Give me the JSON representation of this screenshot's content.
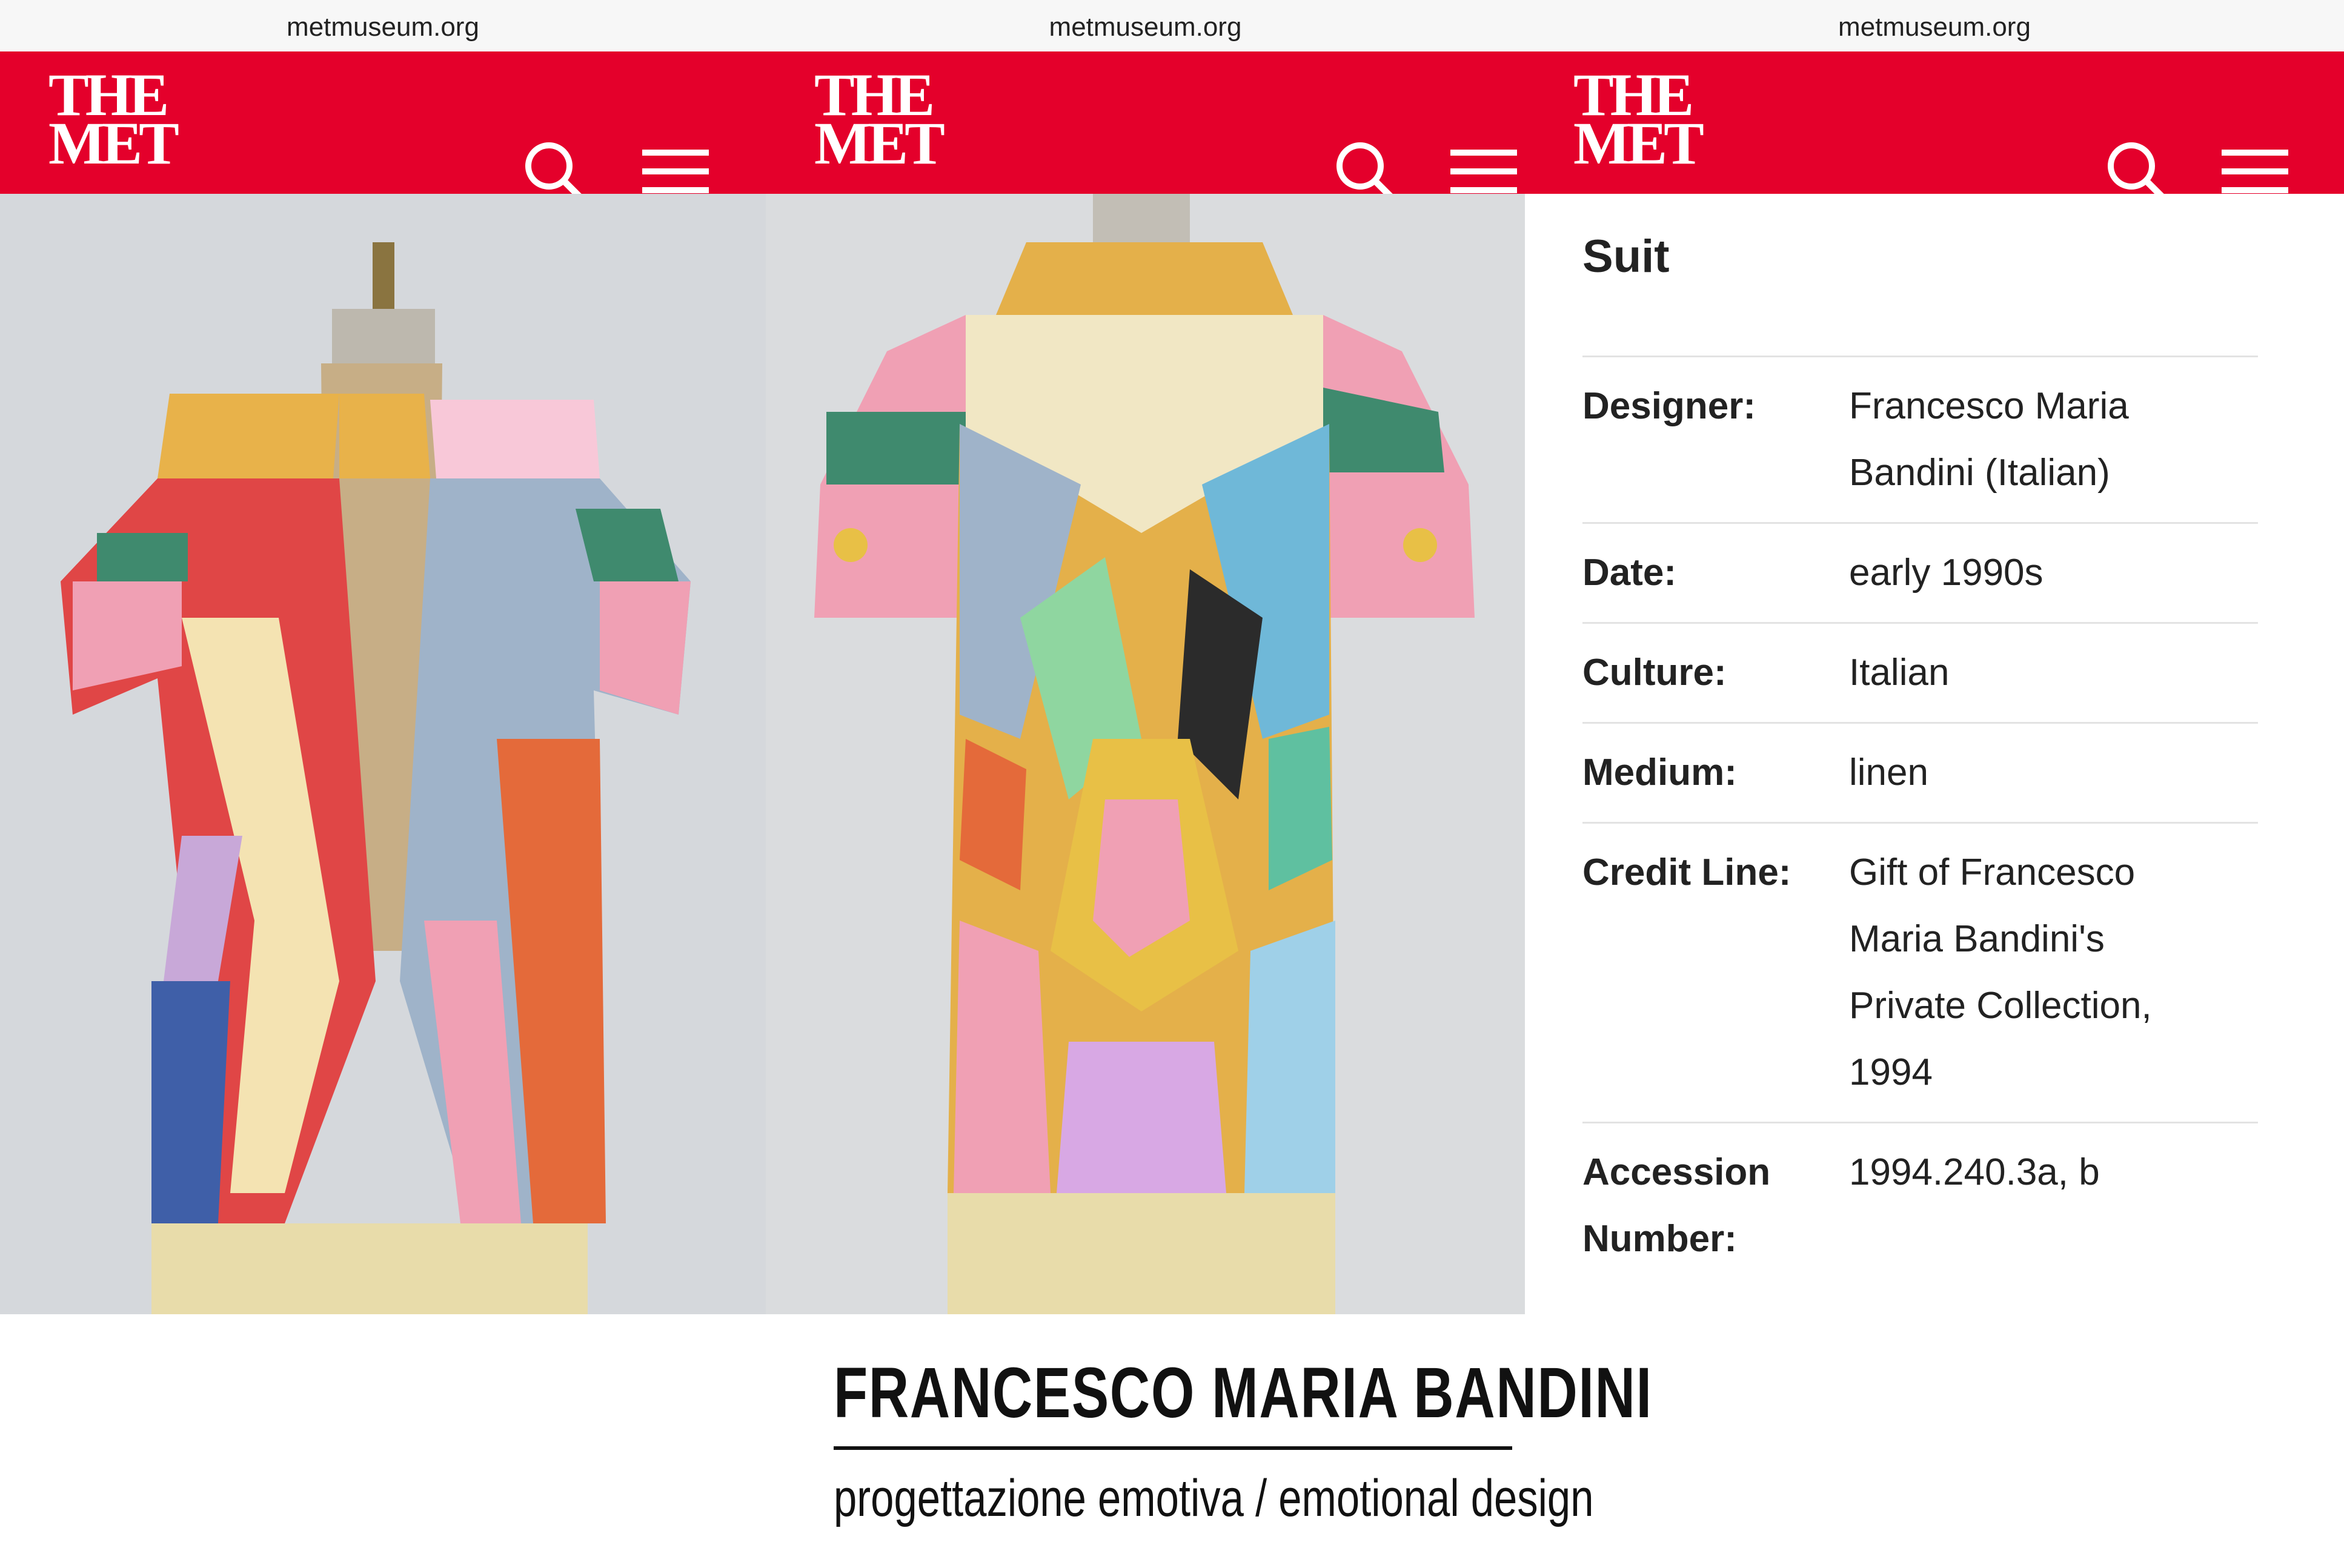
{
  "browser": {
    "url": "metmuseum.org"
  },
  "header": {
    "logo_line1": "THE",
    "logo_line2": "MET"
  },
  "colors": {
    "met_red": "#e4002b",
    "text": "#222222",
    "divider": "#e3e3e3"
  },
  "icons": {
    "search": "search-icon",
    "menu": "hamburger-menu-icon"
  },
  "photos": {
    "front": "suit-front-photo",
    "back": "suit-back-photo"
  },
  "object": {
    "title": "Suit",
    "fields": [
      {
        "label": "Designer:",
        "value": "Francesco Maria\nBandini (Italian)"
      },
      {
        "label": "Date:",
        "value": "early 1990s"
      },
      {
        "label": "Culture:",
        "value": "Italian"
      },
      {
        "label": "Medium:",
        "value": "linen"
      },
      {
        "label": "Credit Line:",
        "value": "Gift of Francesco\nMaria Bandini's\nPrivate Collection,\n1994"
      },
      {
        "label": "Accession\nNumber:",
        "value": "1994.240.3a, b"
      }
    ]
  },
  "caption": {
    "title": "FRANCESCO MARIA BANDINI",
    "subtitle": "progettazione emotiva / emotional design"
  }
}
